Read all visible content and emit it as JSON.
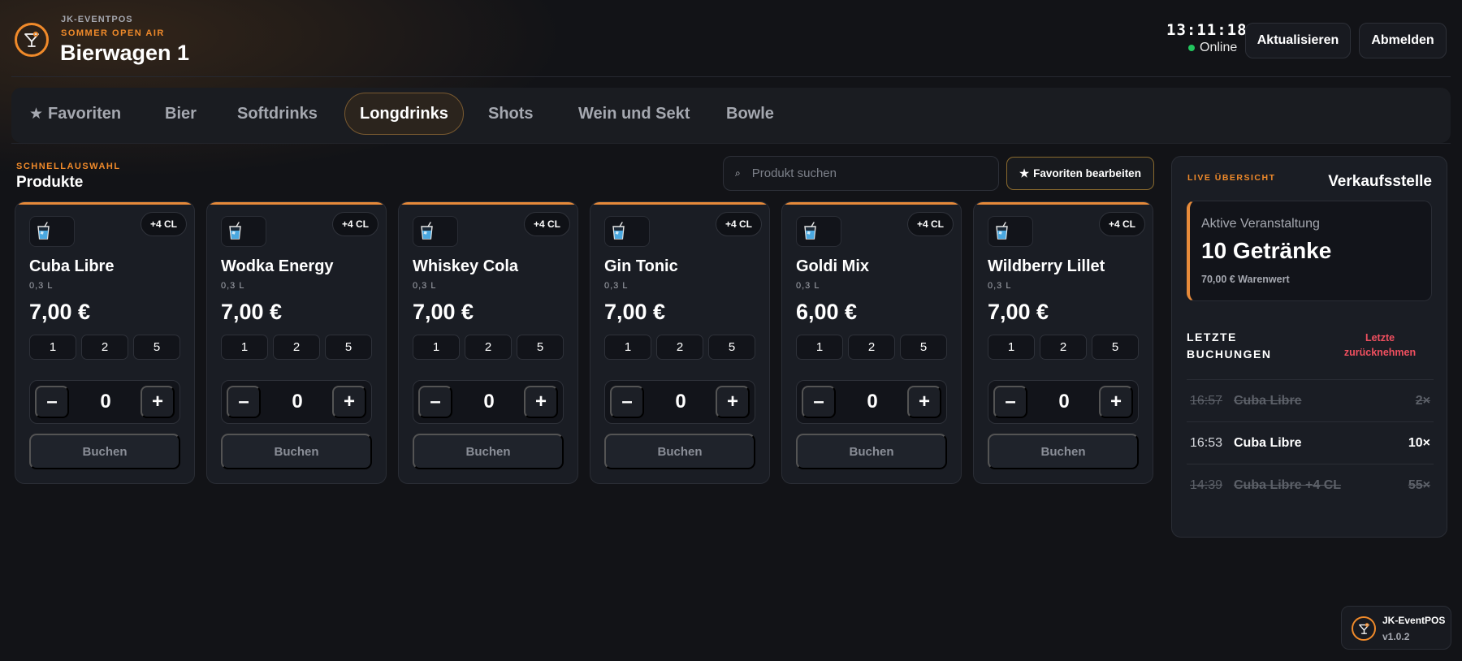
{
  "header": {
    "brand": "JK-EVENTPOS",
    "event": "SOMMER OPEN AIR",
    "station": "Bierwagen 1",
    "clock": "13:11:18",
    "status": "Online",
    "refresh_label": "Aktualisieren",
    "logout_label": "Abmelden"
  },
  "tabs": [
    {
      "label": "Favoriten",
      "icon": "star-icon"
    },
    {
      "label": "Bier"
    },
    {
      "label": "Softdrinks"
    },
    {
      "label": "Longdrinks",
      "active": true
    },
    {
      "label": "Shots"
    },
    {
      "label": "Wein und Sekt"
    },
    {
      "label": "Bowle"
    }
  ],
  "section": {
    "eyebrow": "SCHNELLAUSWAHL",
    "title": "Produkte",
    "search_placeholder": "Produkt suchen",
    "favorites_edit_label": "Favoriten bearbeiten"
  },
  "products": [
    {
      "name": "Cuba Libre",
      "volume": "0,3 L",
      "price": "7,00 €",
      "badge": "+4 CL",
      "quick": [
        "1",
        "2",
        "5"
      ],
      "qty": "0",
      "book": "Buchen"
    },
    {
      "name": "Wodka Energy",
      "volume": "0,3 L",
      "price": "7,00 €",
      "badge": "+4 CL",
      "quick": [
        "1",
        "2",
        "5"
      ],
      "qty": "0",
      "book": "Buchen"
    },
    {
      "name": "Whiskey Cola",
      "volume": "0,3 L",
      "price": "7,00 €",
      "badge": "+4 CL",
      "quick": [
        "1",
        "2",
        "5"
      ],
      "qty": "0",
      "book": "Buchen"
    },
    {
      "name": "Gin Tonic",
      "volume": "0,3 L",
      "price": "7,00 €",
      "badge": "+4 CL",
      "quick": [
        "1",
        "2",
        "5"
      ],
      "qty": "0",
      "book": "Buchen"
    },
    {
      "name": "Goldi Mix",
      "volume": "0,3 L",
      "price": "6,00 €",
      "badge": "+4 CL",
      "quick": [
        "1",
        "2",
        "5"
      ],
      "qty": "0",
      "book": "Buchen"
    },
    {
      "name": "Wildberry Lillet",
      "volume": "0,3 L",
      "price": "7,00 €",
      "badge": "+4 CL",
      "quick": [
        "1",
        "2",
        "5"
      ],
      "qty": "0",
      "book": "Buchen"
    }
  ],
  "panel": {
    "eyebrow": "LIVE ÜBERSICHT",
    "title": "Verkaufsstelle",
    "active_label": "Aktive Veranstaltung",
    "active_value": "10 Getränke",
    "active_sub": "70,00 € Warenwert",
    "recent_title_1": "LETZTE",
    "recent_title_2": "BUCHUNGEN",
    "undo_1": "Letzte",
    "undo_2": "zurücknehmen",
    "bookings": [
      {
        "time": "16:57",
        "product": "Cuba Libre",
        "qty": "2×",
        "cancelled": true
      },
      {
        "time": "16:53",
        "product": "Cuba Libre",
        "qty": "10×",
        "cancelled": false
      },
      {
        "time": "14:39",
        "product": "Cuba Libre +4 CL",
        "qty": "55×",
        "cancelled": true
      }
    ]
  },
  "footer": {
    "app_name": "JK-EventPOS",
    "version": "v1.0.2"
  },
  "colors": {
    "accent": "#f08a2a",
    "online": "#22c55e",
    "danger": "#ef4f5f",
    "background": "#121317"
  }
}
